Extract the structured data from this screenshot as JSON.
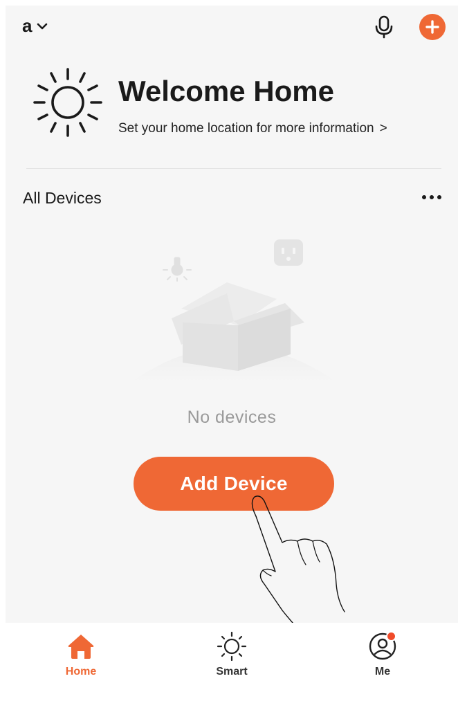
{
  "topbar": {
    "home_name": "a",
    "chevron_icon": "chevron-down-icon",
    "mic_icon": "microphone-icon",
    "add_icon": "plus-icon"
  },
  "welcome": {
    "title": "Welcome Home",
    "subtitle": "Set your home location for more information",
    "subtitle_caret": ">",
    "icon": "sun-icon"
  },
  "devices": {
    "section_title": "All Devices",
    "more_icon": "more-horizontal-icon",
    "empty_text": "No devices",
    "add_button_label": "Add Device"
  },
  "bottom_nav": {
    "items": [
      {
        "label": "Home",
        "icon": "home-icon",
        "active": true
      },
      {
        "label": "Smart",
        "icon": "smart-sun-icon",
        "active": false
      },
      {
        "label": "Me",
        "icon": "user-profile-icon",
        "active": false
      }
    ]
  },
  "colors": {
    "accent": "#ef6835",
    "background": "#f6f6f6",
    "badge": "#f04b2a"
  }
}
